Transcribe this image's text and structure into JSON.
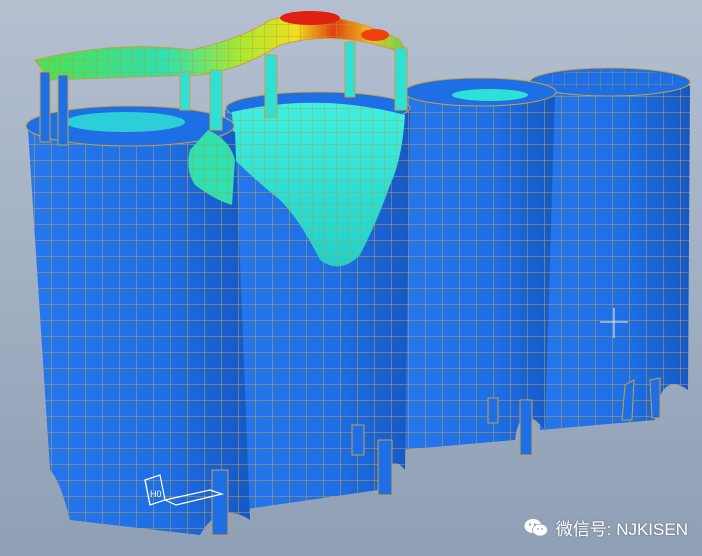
{
  "image": {
    "subject": "silo-fe-contour-model",
    "background_color": "#a9b7c9",
    "colors": {
      "shell_base": "#1e6fe6",
      "mesh_line": "#c8a040",
      "cyan": "#2fe0d6",
      "green": "#4fe050",
      "yellow": "#f0e020",
      "red": "#e02010"
    }
  },
  "watermark": {
    "icon": "wechat-icon",
    "text": "微信号: NJKISEN"
  },
  "triad": {
    "icon": "coordinate-triad-icon"
  }
}
